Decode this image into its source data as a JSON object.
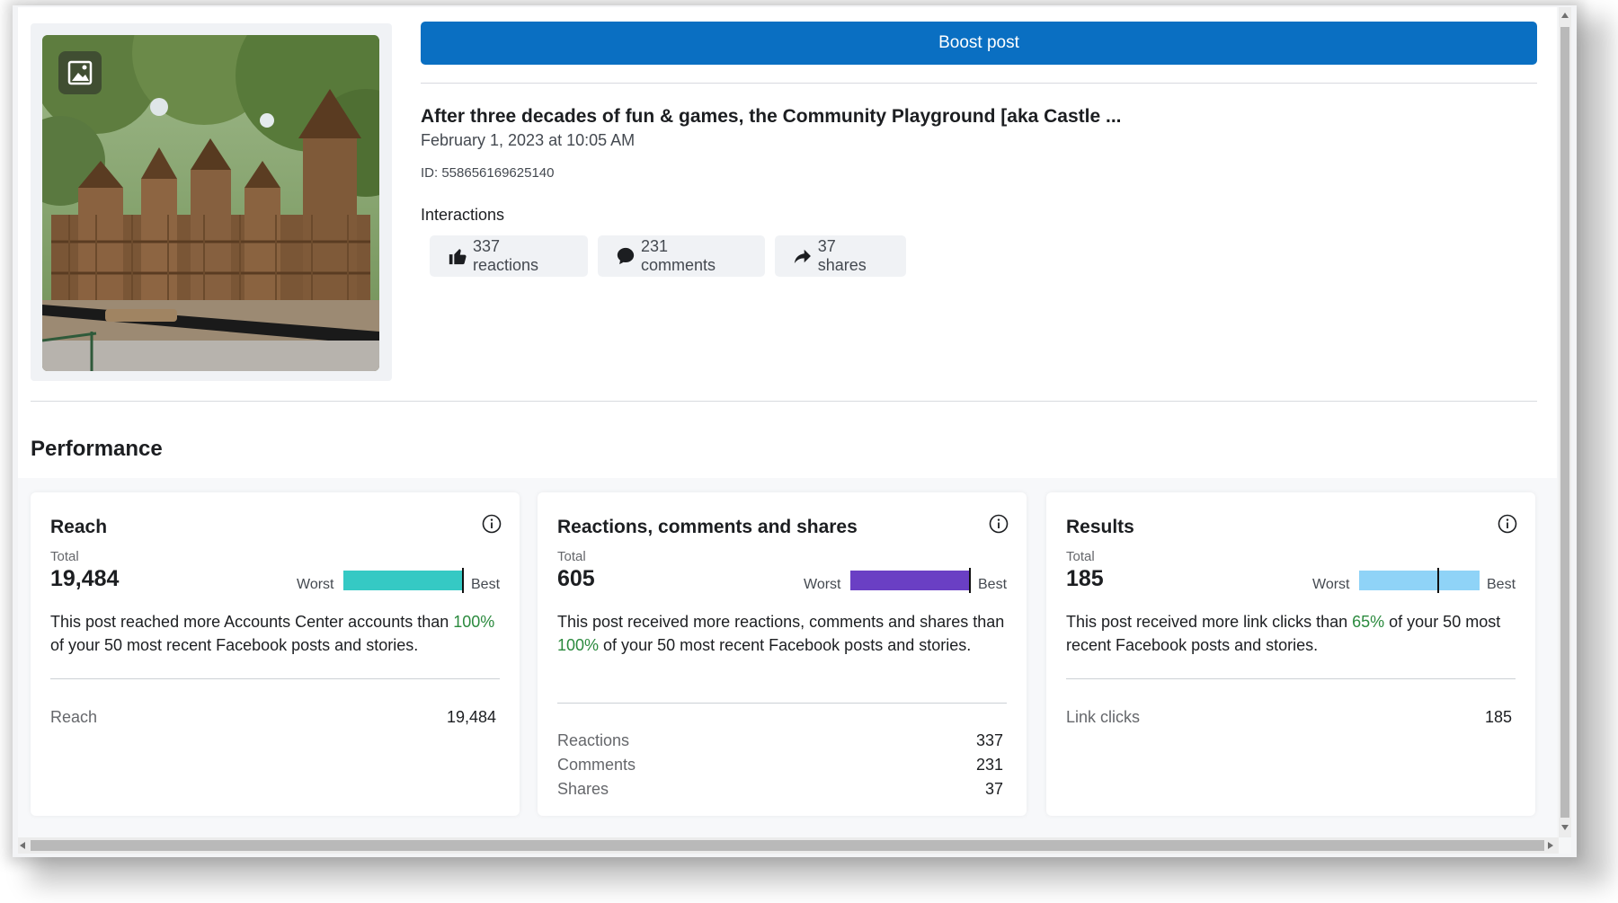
{
  "boost": {
    "label": "Boost post"
  },
  "post": {
    "title": "After three decades of fun & games, the Community Playground [aka Castle ...",
    "date": "February 1, 2023 at 10:05 AM",
    "id": "ID: 558656169625140",
    "interactions_label": "Interactions",
    "chips": {
      "reactions": "337 reactions",
      "comments": "231 comments",
      "shares": "37 shares"
    }
  },
  "performance": {
    "title": "Performance",
    "cards": {
      "reach": {
        "title": "Reach",
        "total_label": "Total",
        "total": "19,484",
        "worst": "Worst",
        "best": "Best",
        "bar_level": 1.0,
        "bar_color": "#35c9c4",
        "desc_pre": "This post reached more Accounts Center accounts than ",
        "desc_pct": "100%",
        "desc_post": " of your 50 most recent Facebook posts and stories.",
        "rows": [
          {
            "label": "Reach",
            "value": "19,484"
          }
        ]
      },
      "engagement": {
        "title": "Reactions, comments and shares",
        "total_label": "Total",
        "total": "605",
        "worst": "Worst",
        "best": "Best",
        "bar_level": 1.0,
        "bar_color": "#6a3fc4",
        "desc_pre": "This post received more reactions, comments and shares than ",
        "desc_pct": "100%",
        "desc_post": " of your 50 most recent Facebook posts and stories.",
        "rows": [
          {
            "label": "Reactions",
            "value": "337"
          },
          {
            "label": "Comments",
            "value": "231"
          },
          {
            "label": "Shares",
            "value": "37"
          }
        ]
      },
      "results": {
        "title": "Results",
        "total_label": "Total",
        "total": "185",
        "worst": "Worst",
        "best": "Best",
        "bar_level": 0.65,
        "bar_color": "#8fd3f7",
        "desc_pre": "This post received more link clicks than ",
        "desc_pct": "65%",
        "desc_post": " of your 50 most recent Facebook posts and stories.",
        "rows": [
          {
            "label": "Link clicks",
            "value": "185"
          }
        ]
      }
    }
  }
}
